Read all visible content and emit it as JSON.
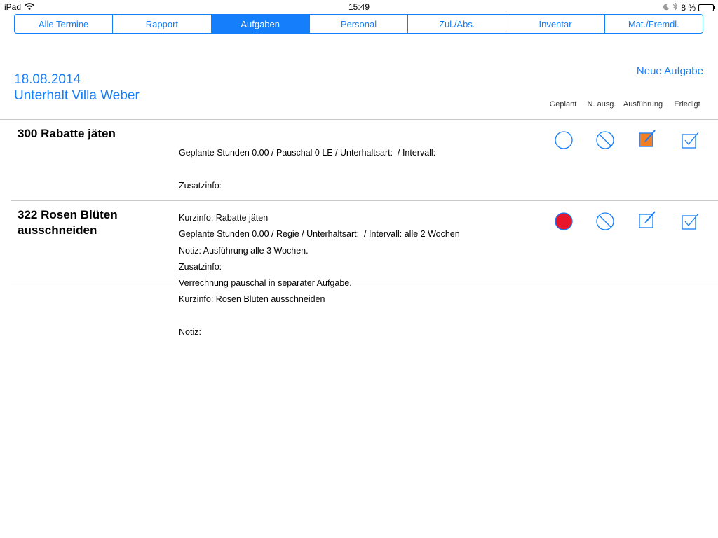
{
  "status_bar": {
    "device": "iPad",
    "time": "15:49",
    "battery": "8 %",
    "battery_level": 0.08
  },
  "tabs": [
    {
      "label": "Alle Termine",
      "active": false
    },
    {
      "label": "Rapport",
      "active": false
    },
    {
      "label": "Aufgaben",
      "active": true
    },
    {
      "label": "Personal",
      "active": false
    },
    {
      "label": "Zul./Abs.",
      "active": false
    },
    {
      "label": "Inventar",
      "active": false
    },
    {
      "label": "Mat./Fremdl.",
      "active": false
    }
  ],
  "header": {
    "date": "18.08.2014",
    "subtitle": "Unterhalt Villa Weber",
    "new_task_label": "Neue Aufgabe"
  },
  "columns": {
    "planned": "Geplant",
    "not_executed": "N. ausg.",
    "execution": "Ausführung",
    "done": "Erledigt"
  },
  "colors": {
    "accent": "#147efb",
    "planned_active": "#e8162a",
    "execution_active": "#f47f20"
  },
  "tasks": [
    {
      "title": "300 Rabatte jäten",
      "detail_lines": [
        "Geplante Stunden 0.00 / Pauschal 0 LE / Unterhaltsart:  / Intervall:",
        "Zusatzinfo:",
        "Kurzinfo: Rabatte jäten",
        "Notiz: Ausführung alle 3 Wochen.",
        "Verrechnung pauschal in separater Aufgabe."
      ],
      "status": {
        "planned": false,
        "not_executed": false,
        "execution": true,
        "done": false
      }
    },
    {
      "title": "322 Rosen Blüten ausschneiden",
      "detail_lines": [
        "Geplante Stunden 0.00 / Regie / Unterhaltsart:  / Intervall: alle 2 Wochen",
        "Zusatzinfo:",
        "Kurzinfo: Rosen Blüten ausschneiden",
        "Notiz:"
      ],
      "status": {
        "planned": true,
        "not_executed": false,
        "execution": false,
        "done": false
      }
    }
  ]
}
